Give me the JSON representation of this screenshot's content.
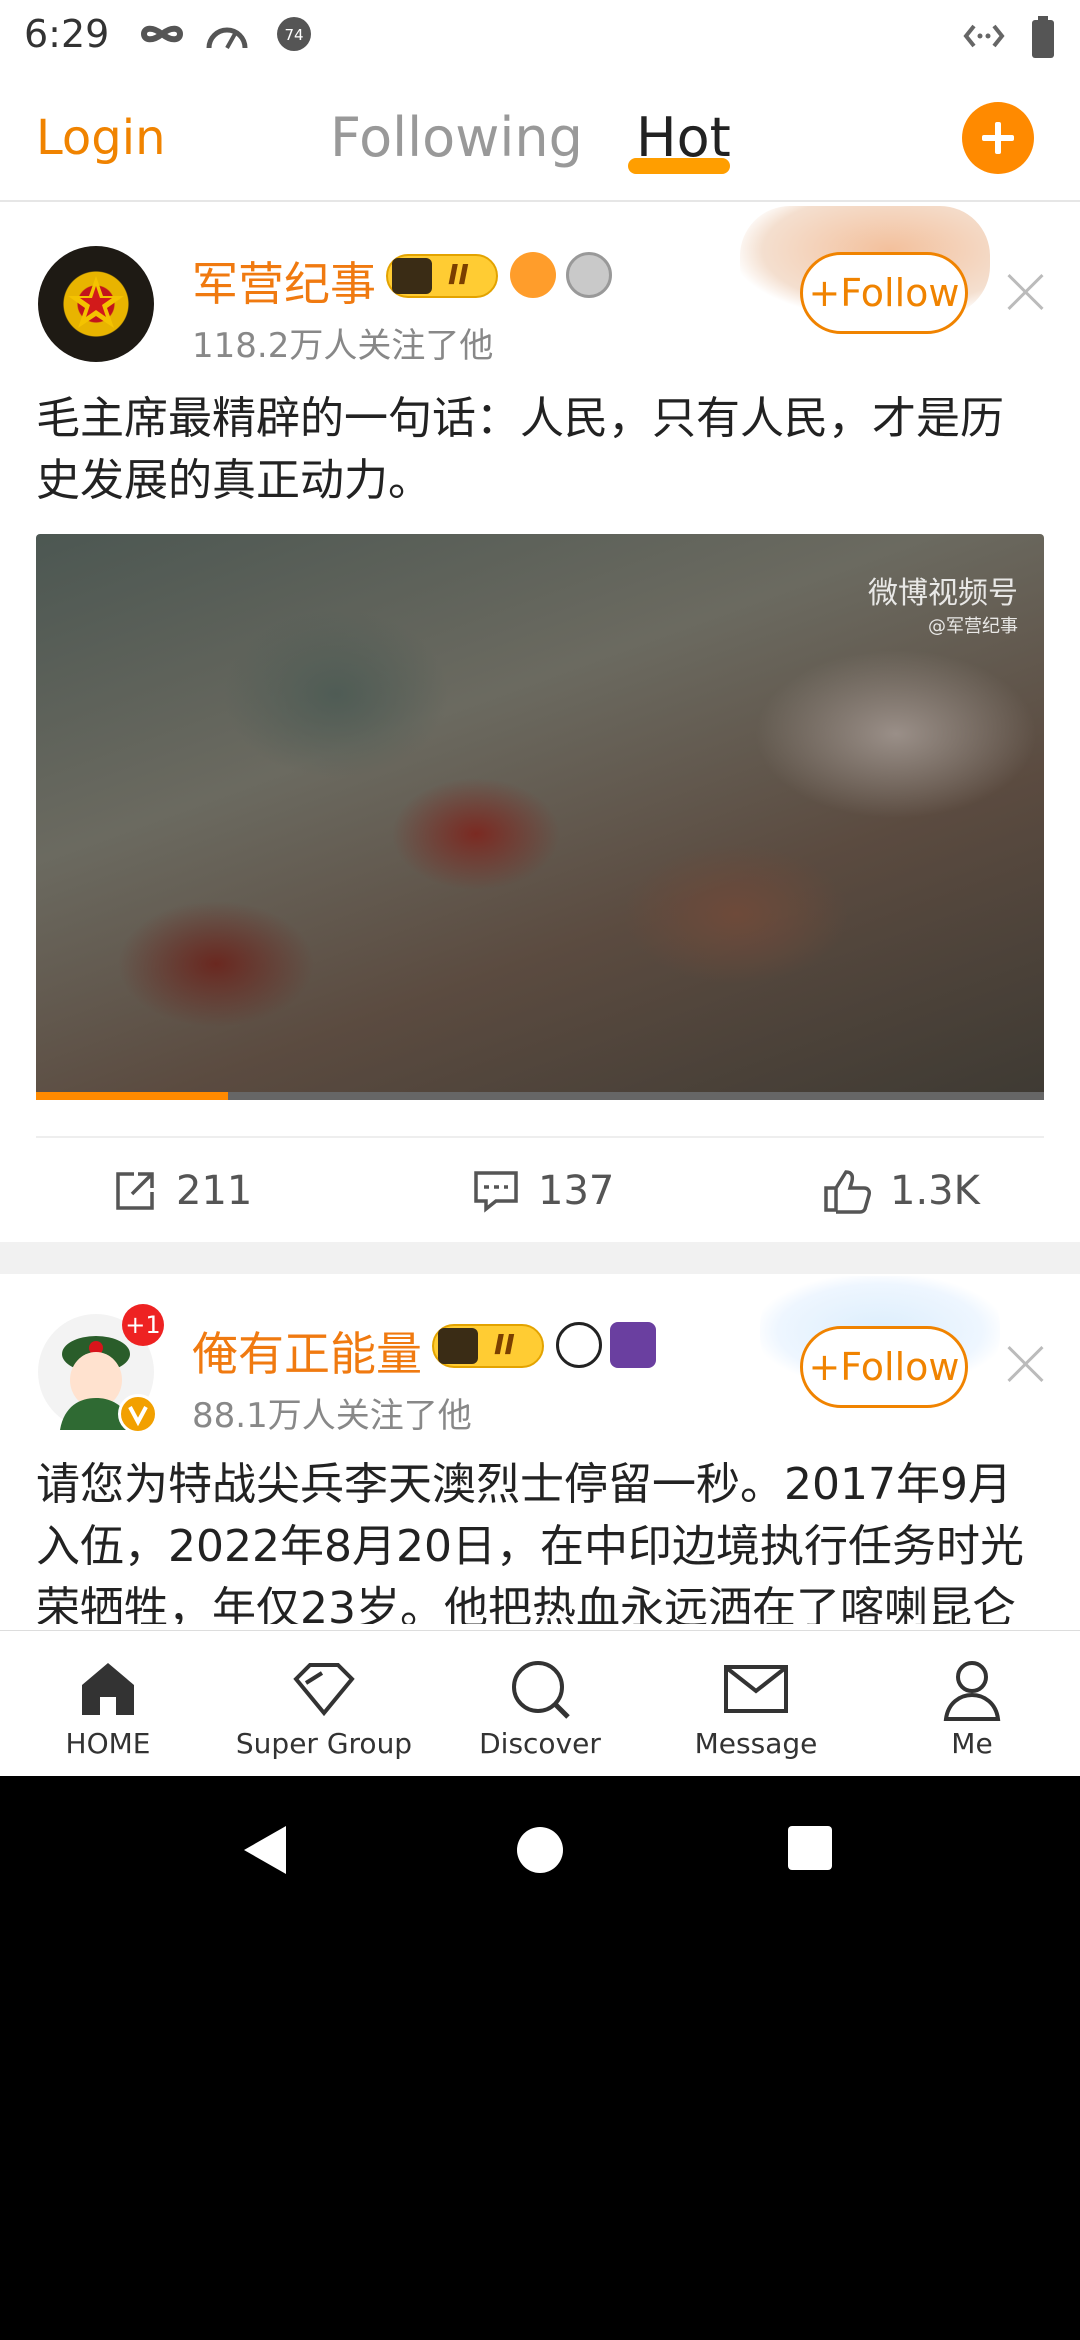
{
  "status_bar": {
    "time": "6:29",
    "notification_badge": "74"
  },
  "header": {
    "login_label": "Login",
    "tabs": [
      {
        "label": "Following",
        "active": false
      },
      {
        "label": "Hot",
        "active": true
      }
    ]
  },
  "posts": [
    {
      "username": "军营纪事",
      "vip_rank": "II",
      "followers": "118.2万人关注了他",
      "follow_label": "+Follow",
      "text": "毛主席最精辟的一句话：人民，只有人民，才是历史发展的真正动力。",
      "video": {
        "watermark": "微博视频号",
        "watermark_sub": "@军营纪事",
        "progress": 0.19
      },
      "stats": {
        "reposts": "211",
        "comments": "137",
        "likes": "1.3K"
      }
    },
    {
      "username": "俺有正能量",
      "vip_rank": "II",
      "avatar_badge": "+1",
      "followers": "88.1万人关注了他",
      "follow_label": "+Follow",
      "text": "请您为特战尖兵李天澳烈士停留一秒。2017年9月入伍，2022年8月20日，在中印边境执行任务时光荣牺牲，年仅23岁。他把热血永远洒在了喀喇昆仑"
    }
  ],
  "bottom_nav": [
    {
      "label": "HOME",
      "icon": "home-icon"
    },
    {
      "label": "Super Group",
      "icon": "diamond-icon"
    },
    {
      "label": "Discover",
      "icon": "search-icon"
    },
    {
      "label": "Message",
      "icon": "mail-icon"
    },
    {
      "label": "Me",
      "icon": "person-icon"
    }
  ],
  "colors": {
    "accent": "#f08300",
    "text": "#222222"
  }
}
